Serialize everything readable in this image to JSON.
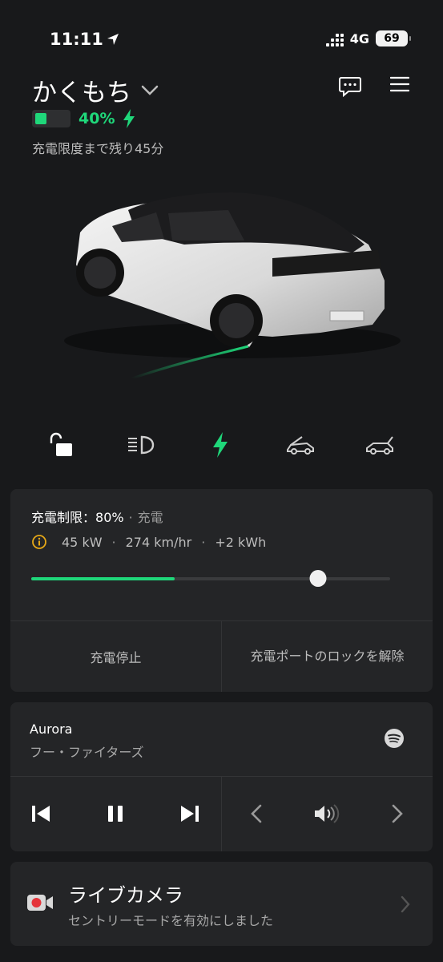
{
  "status_bar": {
    "time": "11:11",
    "network": "4G",
    "battery": "69"
  },
  "header": {
    "vehicle_name": "かくもち",
    "charge_percent": "40%",
    "charge_remaining": "充電限度まで残り45分"
  },
  "quick_controls": [
    "lock-open-icon",
    "headlights-icon",
    "charging-bolt-icon",
    "frunk-icon",
    "trunk-icon"
  ],
  "charging": {
    "limit_label": "充電制限：",
    "limit_value": "80%",
    "separator": "·",
    "status": "充電",
    "power": "45 kW",
    "rate": "274 km/hr",
    "energy": "+2 kWh",
    "current_level": 0.4,
    "limit_level": 0.8,
    "stop_button": "充電停止",
    "unlock_port_button": "充電ポートのロックを解除"
  },
  "media": {
    "title": "Aurora",
    "artist": "フー・ファイターズ",
    "source_icon": "spotify-icon"
  },
  "camera": {
    "title": "ライブカメラ",
    "subtitle": "セントリーモードを有効にしました"
  },
  "colors": {
    "accent": "#1fd77a",
    "background": "#18191b",
    "card": "#242527",
    "record": "#e5353b"
  }
}
